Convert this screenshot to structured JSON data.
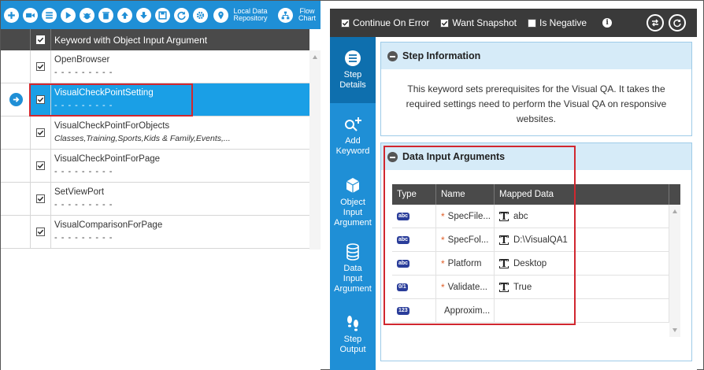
{
  "toolbar": {
    "local_repo_label": "Local Data Repository",
    "flow_chart_label": "Flow Chart"
  },
  "grid": {
    "header": "Keyword with Object Input Argument",
    "rows": [
      {
        "name": "OpenBrowser",
        "sub": "- - - - - - - - -",
        "selected": false
      },
      {
        "name": "VisualCheckPointSetting",
        "sub": "- - - - - - - - -",
        "selected": true
      },
      {
        "name": "VisualCheckPointForObjects",
        "sub": "Classes,Training,Sports,Kids & Family,Events,...",
        "selected": false
      },
      {
        "name": "VisualCheckPointForPage",
        "sub": "- - - - - - - - -",
        "selected": false
      },
      {
        "name": "SetViewPort",
        "sub": "- - - - - - - - -",
        "selected": false
      },
      {
        "name": "VisualComparisonForPage",
        "sub": "- - - - - - - - -",
        "selected": false
      }
    ]
  },
  "options": {
    "continue_on_error": "Continue On Error",
    "want_snapshot": "Want Snapshot",
    "is_negative": "Is Negative"
  },
  "sidebar": {
    "items": [
      {
        "line1": "Step",
        "line2": "Details",
        "line3": ""
      },
      {
        "line1": "Add",
        "line2": "Keyword",
        "line3": ""
      },
      {
        "line1": "Object",
        "line2": "Input",
        "line3": "Argument"
      },
      {
        "line1": "Data",
        "line2": "Input",
        "line3": "Argument"
      },
      {
        "line1": "Step",
        "line2": "Output",
        "line3": ""
      }
    ]
  },
  "step_info": {
    "title": "Step Information",
    "description": "This keyword sets prerequisites for the Visual QA. It takes the required settings need to perform the Visual QA on responsive websites."
  },
  "data_input": {
    "title": "Data Input Arguments",
    "columns": [
      "Type",
      "Name",
      "Mapped Data"
    ],
    "rows": [
      {
        "type": "abc",
        "name": "SpecFile...",
        "required": "*",
        "value": "abc"
      },
      {
        "type": "abc",
        "name": "SpecFol...",
        "required": "*",
        "value": "D:\\VisualQA1"
      },
      {
        "type": "abc",
        "name": "Platform",
        "required": "*",
        "value": "Desktop"
      },
      {
        "type": "0/1",
        "name": "Validate...",
        "required": "*",
        "value": "True"
      },
      {
        "type": "123",
        "name": "Approxim...",
        "required": "",
        "value": ""
      }
    ]
  },
  "colors": {
    "accent": "#1f8fd6",
    "selected_row": "#1a9fe6",
    "highlight": "#d1272f"
  }
}
